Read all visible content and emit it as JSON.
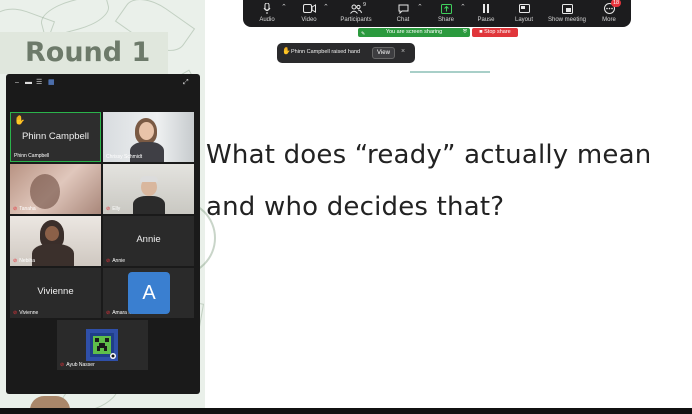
{
  "toolbar": {
    "items": [
      {
        "label": "Audio",
        "icon": "mic-icon"
      },
      {
        "label": "Video",
        "icon": "video-icon"
      },
      {
        "label": "Participants",
        "icon": "participants-icon",
        "count": "9"
      },
      {
        "label": "Chat",
        "icon": "chat-icon"
      },
      {
        "label": "Share",
        "icon": "share-icon"
      },
      {
        "label": "Pause",
        "icon": "pause-icon"
      },
      {
        "label": "Layout",
        "icon": "layout-icon"
      },
      {
        "label": "Show meeting",
        "icon": "show-meeting-icon"
      },
      {
        "label": "More",
        "icon": "more-icon",
        "badge": "18"
      }
    ]
  },
  "share_bar": {
    "status": "You are screen sharing",
    "stop_label": "Stop share"
  },
  "notification": {
    "text": "Phinn Campbell raised hand",
    "view_label": "View",
    "close_label": "×"
  },
  "slide": {
    "title": "Round 1",
    "line1": "What does “ready” actually mean",
    "line2": "and who decides that?"
  },
  "gallery": {
    "tiles": [
      {
        "name": "Phinn Campbell",
        "display": "Phinn Campbell",
        "raised_hand": true,
        "active": true
      },
      {
        "name": "Chrissy Schmidt",
        "video": true
      },
      {
        "name": "Tanaha",
        "video": true,
        "muted": true
      },
      {
        "name": "Elly",
        "video": true,
        "muted": true
      },
      {
        "name": "Nebiha",
        "video": true,
        "muted": true
      },
      {
        "name": "Annie",
        "display": "Annie",
        "muted": true
      },
      {
        "name": "Vivienne",
        "display": "Vivienne",
        "muted": true
      },
      {
        "name": "Amara Moore",
        "avatar_letter": "A",
        "muted": true
      },
      {
        "name": "Ayub Nasser",
        "muted": true
      }
    ]
  },
  "colors": {
    "toolbar_bg": "#1c1c1e",
    "share_green": "#2b9a3e",
    "stop_red": "#e0363b",
    "active_border": "#2bb34b",
    "hand_yellow": "#f2c233",
    "avatar_blue": "#3a7fd0"
  }
}
